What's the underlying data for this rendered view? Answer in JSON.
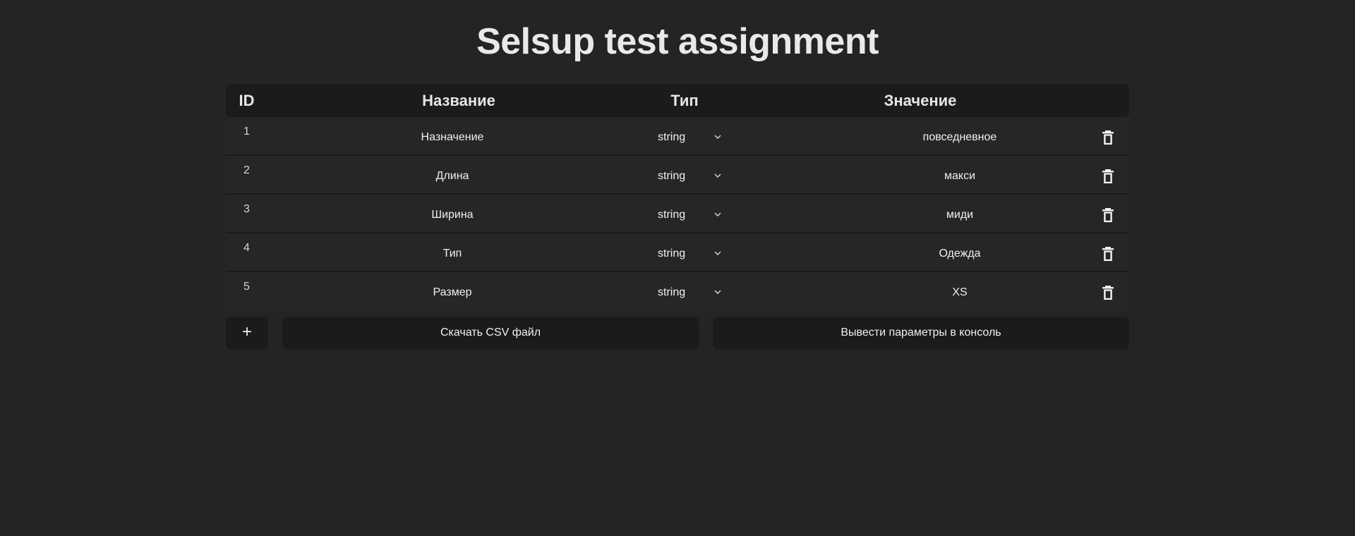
{
  "page": {
    "title": "Selsup test assignment"
  },
  "table": {
    "headers": {
      "id": "ID",
      "name": "Название",
      "type": "Тип",
      "value": "Значение"
    },
    "rows": [
      {
        "id": "1",
        "name": "Назначение",
        "type": "string",
        "value": "повседневное"
      },
      {
        "id": "2",
        "name": "Длина",
        "type": "string",
        "value": "макси"
      },
      {
        "id": "3",
        "name": "Ширина",
        "type": "string",
        "value": "миди"
      },
      {
        "id": "4",
        "name": "Тип",
        "type": "string",
        "value": "Одежда"
      },
      {
        "id": "5",
        "name": "Размер",
        "type": "string",
        "value": "XS"
      }
    ]
  },
  "actions": {
    "add_label": "+",
    "csv_label": "Скачать CSV файл",
    "console_label": "Вывести параметры в консоль"
  },
  "icons": {
    "row_delete": "trash-icon",
    "type_dropdown": "chevron-down-icon"
  },
  "colors": {
    "background": "#242424",
    "surface": "#1b1b1b",
    "text": "#ececec"
  }
}
